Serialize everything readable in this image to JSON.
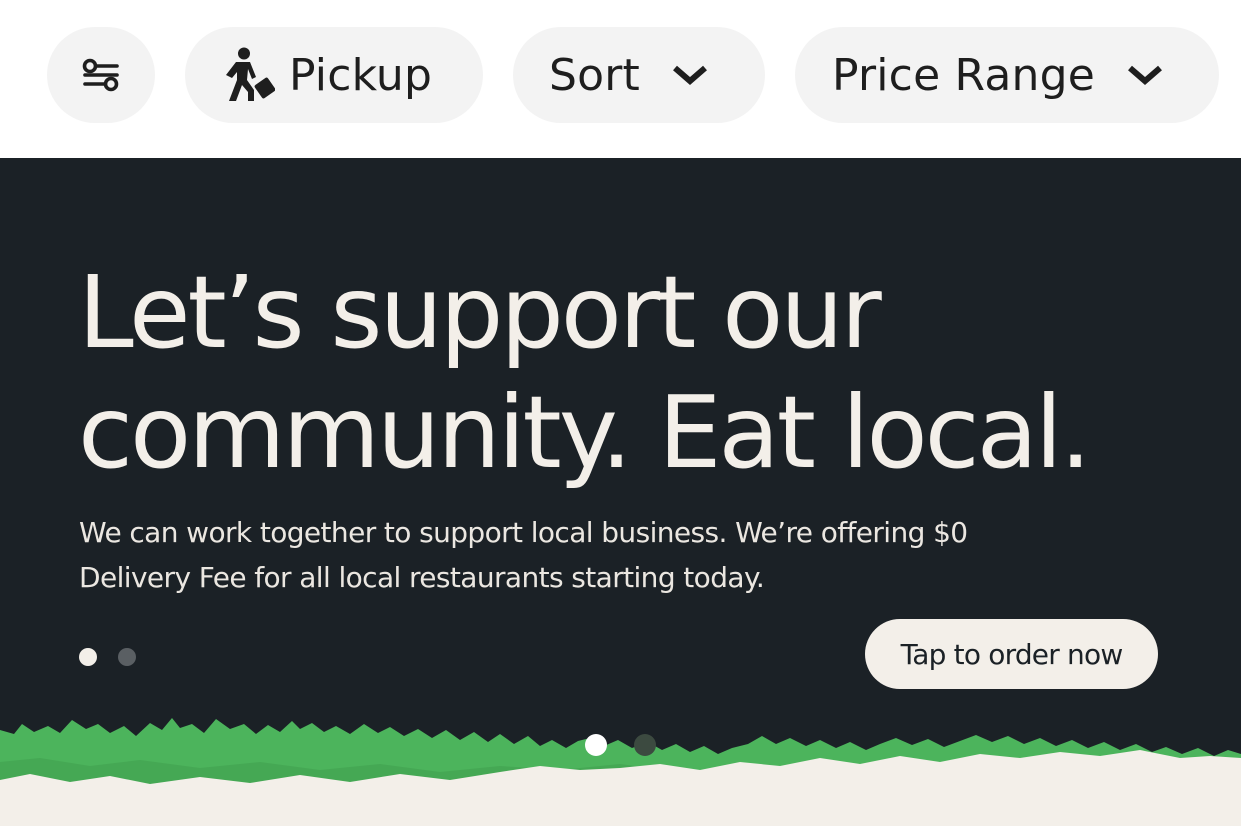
{
  "filters": {
    "filter_icon": "sliders-icon",
    "pickup": {
      "label": "Pickup",
      "icon": "walking-person-icon"
    },
    "sort": {
      "label": "Sort",
      "icon": "chevron-down-icon"
    },
    "price_range": {
      "label": "Price Range",
      "icon": "chevron-down-icon"
    }
  },
  "promo": {
    "headline_line1": "Let’s support our",
    "headline_line2": "community. Eat local.",
    "body_line1": "We can work together to support local business. We’re offering $0",
    "body_line2": "Delivery Fee for all local restaurants starting today.",
    "cta_label": "Tap to order now",
    "inner_slide_count": 2,
    "inner_active_slide": 1,
    "outer_slide_count": 2,
    "outer_active_slide": 1
  },
  "colors": {
    "banner_bg": "#1b2126",
    "headline": "#f3efe9",
    "grass": "#4cb45c",
    "ground": "#f3efe9",
    "chip_bg": "#f3f3f3"
  }
}
